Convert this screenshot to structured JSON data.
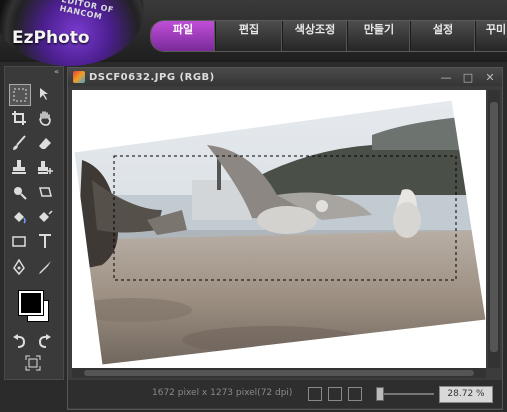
{
  "app": {
    "name": "EzPhoto",
    "ring_text": "EDITOR OF HANCOM"
  },
  "menu": {
    "items": [
      {
        "label": "파일",
        "active": true
      },
      {
        "label": "편집",
        "active": false
      },
      {
        "label": "색상조정",
        "active": false
      },
      {
        "label": "만들기",
        "active": false
      },
      {
        "label": "설정",
        "active": false
      },
      {
        "label": "꾸미",
        "active": false
      }
    ]
  },
  "toolbox": {
    "collapse_label": "«",
    "tools": [
      {
        "name": "rect-select-icon",
        "selected": true
      },
      {
        "name": "move-icon"
      },
      {
        "name": "crop-icon"
      },
      {
        "name": "hand-icon"
      },
      {
        "name": "brush-icon"
      },
      {
        "name": "eraser-icon"
      },
      {
        "name": "stamp-icon"
      },
      {
        "name": "stamp-plus-icon"
      },
      {
        "name": "smudge-icon"
      },
      {
        "name": "lasso-icon"
      },
      {
        "name": "fill-bucket-icon"
      },
      {
        "name": "fill-bucket-alt-icon"
      },
      {
        "name": "rectangle-shape-icon"
      },
      {
        "name": "text-icon"
      },
      {
        "name": "pen-icon"
      },
      {
        "name": "eyedropper-icon"
      },
      {
        "name": "undo-icon"
      },
      {
        "name": "redo-icon"
      },
      {
        "name": "fit-screen-icon"
      }
    ],
    "foreground_color": "#000000",
    "background_color": "#ffffff"
  },
  "document": {
    "title": "DSCF0632.JPG (RGB)",
    "window_buttons": {
      "minimize": "—",
      "maximize": "□",
      "close": "✕"
    },
    "status_text": "1672 pixel x 1273 pixel(72 dpi)",
    "zoom": "28.72 %"
  },
  "colors": {
    "accent": "#a040c0",
    "chrome": "#3a3a3a"
  }
}
